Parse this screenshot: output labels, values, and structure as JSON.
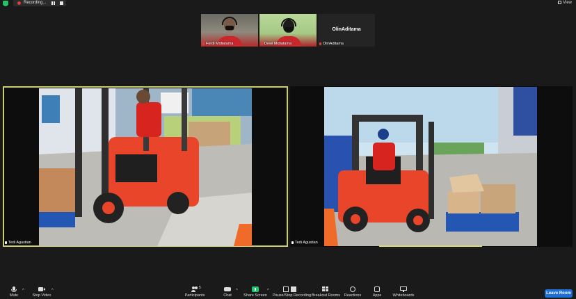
{
  "topbar": {
    "recording_label": "Recording...",
    "view_label": "View"
  },
  "thumbnails": [
    {
      "name": "Ferdi Midiatama"
    },
    {
      "name": "Dewi Midiatama"
    },
    {
      "title": "OlinAditama",
      "name": "OlinAditama"
    }
  ],
  "main_tiles": [
    {
      "name": "Tedi Agustian"
    },
    {
      "name": "Tedi Agustian"
    }
  ],
  "toolbar": {
    "mute": "Mute",
    "stop_video": "Stop Video",
    "participants": "Participants",
    "participants_count": "5",
    "chat": "Chat",
    "share_screen": "Share Screen",
    "record": "Pause/Stop Recording",
    "breakout": "Breakout Rooms",
    "reactions": "Reactions",
    "apps": "Apps",
    "whiteboards": "Whiteboards",
    "leave": "Leave Room"
  },
  "colors": {
    "active_speaker_outline": "#c9cf6e",
    "share_green": "#23c46b",
    "leave_blue": "#1f6fd6",
    "recording_red": "#e03b3b"
  }
}
